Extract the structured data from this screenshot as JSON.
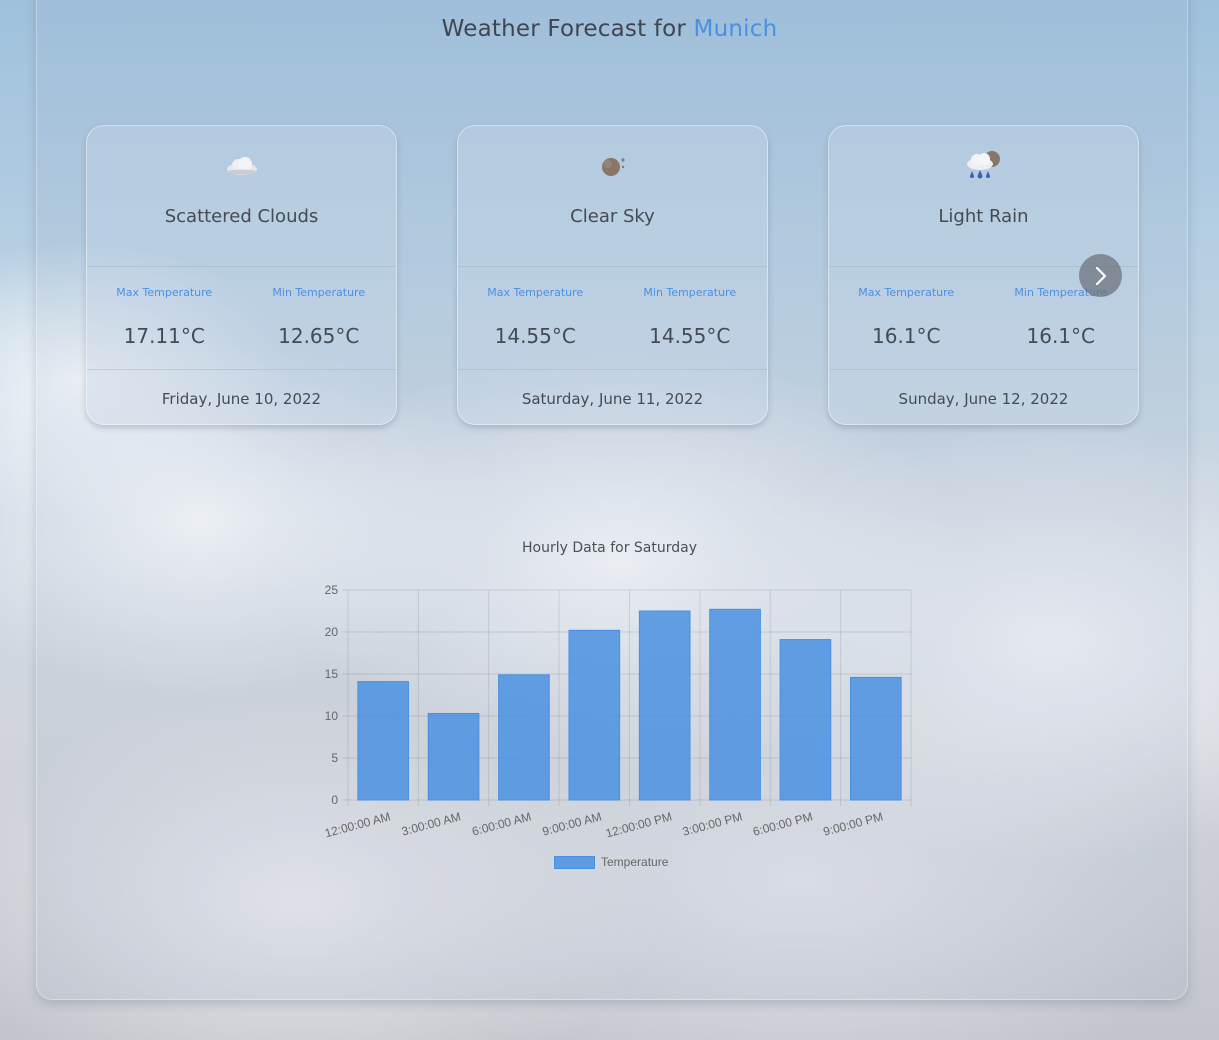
{
  "header": {
    "title_prefix": "Weather Forecast for ",
    "city": "Munich"
  },
  "cards": [
    {
      "icon": "scattered-clouds-icon",
      "description": "Scattered Clouds",
      "max_label": "Max Temperature",
      "min_label": "Min Temperature",
      "max_temp": "17.11°C",
      "min_temp": "12.65°C",
      "date": "Friday, June 10, 2022"
    },
    {
      "icon": "clear-sky-night-icon",
      "description": "Clear Sky",
      "max_label": "Max Temperature",
      "min_label": "Min Temperature",
      "max_temp": "14.55°C",
      "min_temp": "14.55°C",
      "date": "Saturday, June 11, 2022"
    },
    {
      "icon": "light-rain-icon",
      "description": "Light Rain",
      "max_label": "Max Temperature",
      "min_label": "Min Temperature",
      "max_temp": "16.1°C",
      "min_temp": "16.1°C",
      "date": "Sunday, June 12, 2022"
    }
  ],
  "carousel": {
    "next_icon": "chevron-right-icon"
  },
  "colors": {
    "accent": "#4a90e2",
    "bar_fill": "#4a90e2"
  },
  "chart_data": {
    "type": "bar",
    "title": "Hourly Data for Saturday",
    "categories": [
      "12:00:00 AM",
      "3:00:00 AM",
      "6:00:00 AM",
      "9:00:00 AM",
      "12:00:00 PM",
      "3:00:00 PM",
      "6:00:00 PM",
      "9:00:00 PM"
    ],
    "series": [
      {
        "name": "Temperature",
        "values": [
          14.1,
          10.3,
          14.9,
          20.2,
          22.5,
          22.7,
          19.1,
          14.6
        ]
      }
    ],
    "ylim": [
      0,
      25
    ],
    "yticks": [
      0,
      5,
      10,
      15,
      20,
      25
    ],
    "grid": true,
    "legend": "bottom"
  }
}
